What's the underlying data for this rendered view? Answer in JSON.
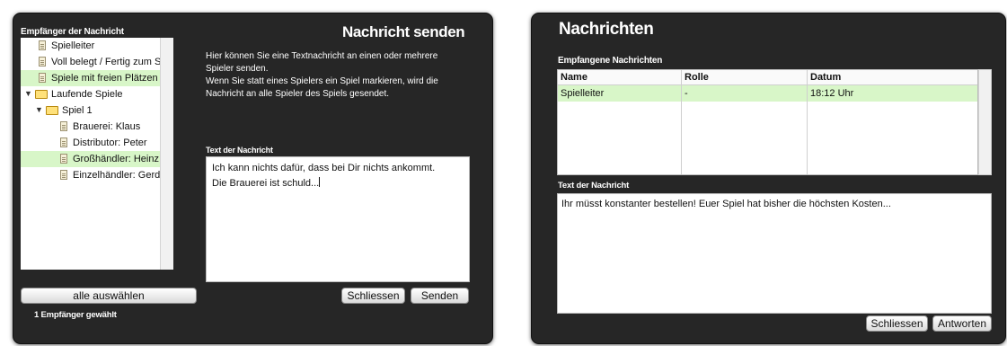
{
  "send_dialog": {
    "recipients_label": "Empfänger der Nachricht",
    "title": "Nachricht senden",
    "tree": [
      {
        "label": "Spielleiter",
        "type": "doc",
        "indent": 0,
        "selected": false
      },
      {
        "label": "Voll belegt / Fertig zum Start",
        "type": "doc",
        "indent": 0,
        "selected": false
      },
      {
        "label": "Spiele mit freien Plätzen",
        "type": "doc",
        "indent": 0,
        "selected": true
      },
      {
        "label": "Laufende Spiele",
        "type": "folder",
        "indent": 0,
        "selected": false
      },
      {
        "label": "Spiel 1",
        "type": "folder",
        "indent": 1,
        "selected": false
      },
      {
        "label": "Brauerei: Klaus",
        "type": "doc",
        "indent": 2,
        "selected": false
      },
      {
        "label": "Distributor: Peter",
        "type": "doc",
        "indent": 2,
        "selected": false
      },
      {
        "label": "Großhändler: Heinz",
        "type": "doc",
        "indent": 2,
        "selected": true
      },
      {
        "label": "Einzelhändler: Gerd",
        "type": "doc",
        "indent": 2,
        "selected": false
      }
    ],
    "select_all_label": "alle auswählen",
    "selected_count": "1 Empfänger gewählt",
    "description_1": "Hier können Sie eine Textnachricht an einen oder mehrere Spieler senden.",
    "description_2": "Wenn Sie statt eines Spielers ein Spiel markieren, wird die Nachricht an alle Spieler des Spiels gesendet.",
    "text_label": "Text der Nachricht",
    "message_line_1": "Ich kann nichts dafür, dass bei Dir nichts ankommt.",
    "message_line_2": "Die Brauerei ist schuld...",
    "close_label": "Schliessen",
    "send_label": "Senden"
  },
  "messages_dialog": {
    "title": "Nachrichten",
    "received_label": "Empfangene Nachrichten",
    "columns": [
      "Name",
      "Rolle",
      "Datum"
    ],
    "rows": [
      {
        "name": "Spielleiter",
        "role": "-",
        "date": "18:12 Uhr"
      }
    ],
    "text_label": "Text der Nachricht",
    "message_text": "Ihr müsst konstanter bestellen! Euer Spiel hat bisher die höchsten Kosten...",
    "close_label": "Schliessen",
    "reply_label": "Antworten"
  },
  "colors": {
    "panel": "#262626",
    "selection": "#d8f6c8"
  }
}
